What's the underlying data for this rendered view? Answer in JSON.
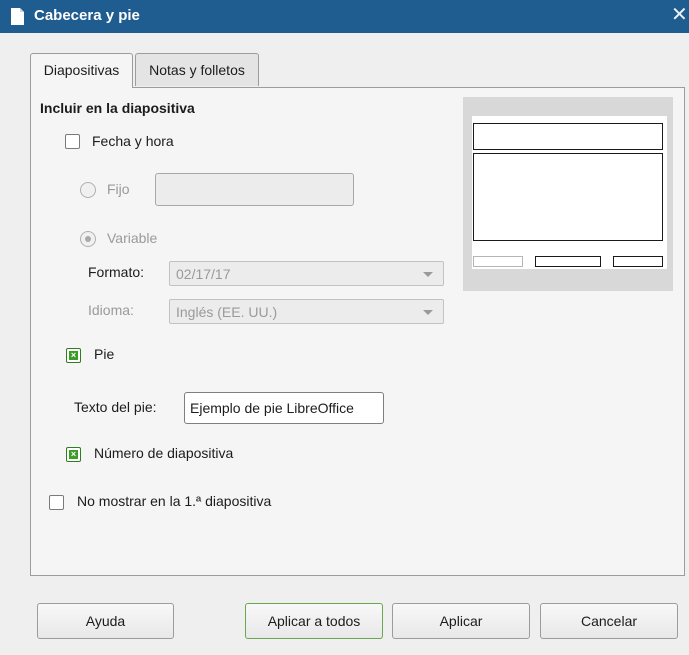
{
  "window": {
    "title": "Cabecera y pie",
    "close_glyph": "✕"
  },
  "tabs": [
    {
      "label": "Diapositivas",
      "active": true
    },
    {
      "label": "Notas y folletos",
      "active": false
    }
  ],
  "section": {
    "heading": "Incluir en la diapositiva"
  },
  "date_time": {
    "label": "Fecha y hora",
    "checked": false,
    "fixed": {
      "label": "Fijo",
      "value": ""
    },
    "variable": {
      "label": "Variable",
      "selected": true
    },
    "format": {
      "label": "Formato:",
      "value": "02/17/17"
    },
    "language": {
      "label": "Idioma:",
      "value": "Inglés (EE. UU.)"
    }
  },
  "footer": {
    "label": "Pie",
    "checked": true,
    "text_label": "Texto del pie:",
    "text_value": "Ejemplo de pie LibreOffice"
  },
  "slide_number": {
    "label": "Número de diapositiva",
    "checked": true
  },
  "hide_first": {
    "label": "No mostrar en la 1.ª diapositiva",
    "checked": false
  },
  "buttons": {
    "help": "Ayuda",
    "apply_all": "Aplicar a todos",
    "apply": "Aplicar",
    "cancel": "Cancelar"
  },
  "colors": {
    "titlebar": "#1f5c8f",
    "check_green": "#3d9b2a"
  }
}
